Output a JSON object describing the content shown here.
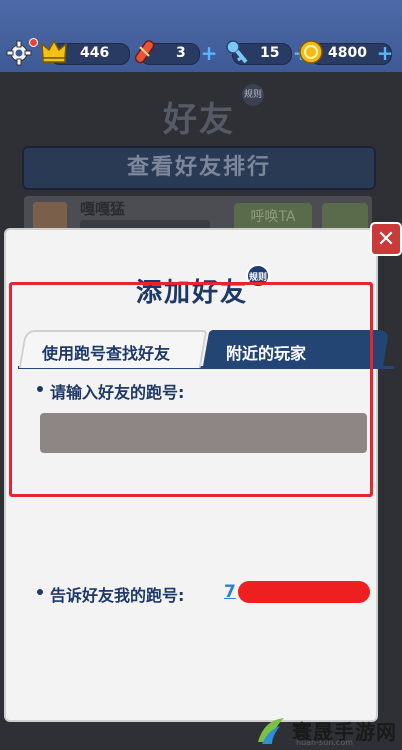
{
  "topbar": {
    "crowns": "446",
    "boards": "3",
    "keys": "15",
    "coins": "4800",
    "icons": [
      "gear-icon",
      "crown-icon",
      "hoverboard-icon",
      "key-icon",
      "coin-icon",
      "plus-icon"
    ],
    "colors": {
      "bar": "#4d6aa8",
      "plus": "#5ab4ff",
      "coin": "#f2b918"
    }
  },
  "background": {
    "title": "好友",
    "rules_badge": "规则",
    "ranking_button": "查看好友排行",
    "friend_name": "嘎嘎猛",
    "call_button": "呼唤TA"
  },
  "modal": {
    "title": "添加好友",
    "rules_badge": "规则",
    "tabs": [
      {
        "label": "使用跑号查找好友",
        "active": true
      },
      {
        "label": "附近的玩家",
        "active": false
      }
    ],
    "prompt": "请输入好友的跑号:",
    "input_placeholder": "",
    "tell_label": "告诉好友我的跑号:",
    "my_id_visible": "7",
    "close_label": "✕"
  },
  "watermark": {
    "name": "寰晟手游网",
    "url": "huan-sun.com"
  }
}
